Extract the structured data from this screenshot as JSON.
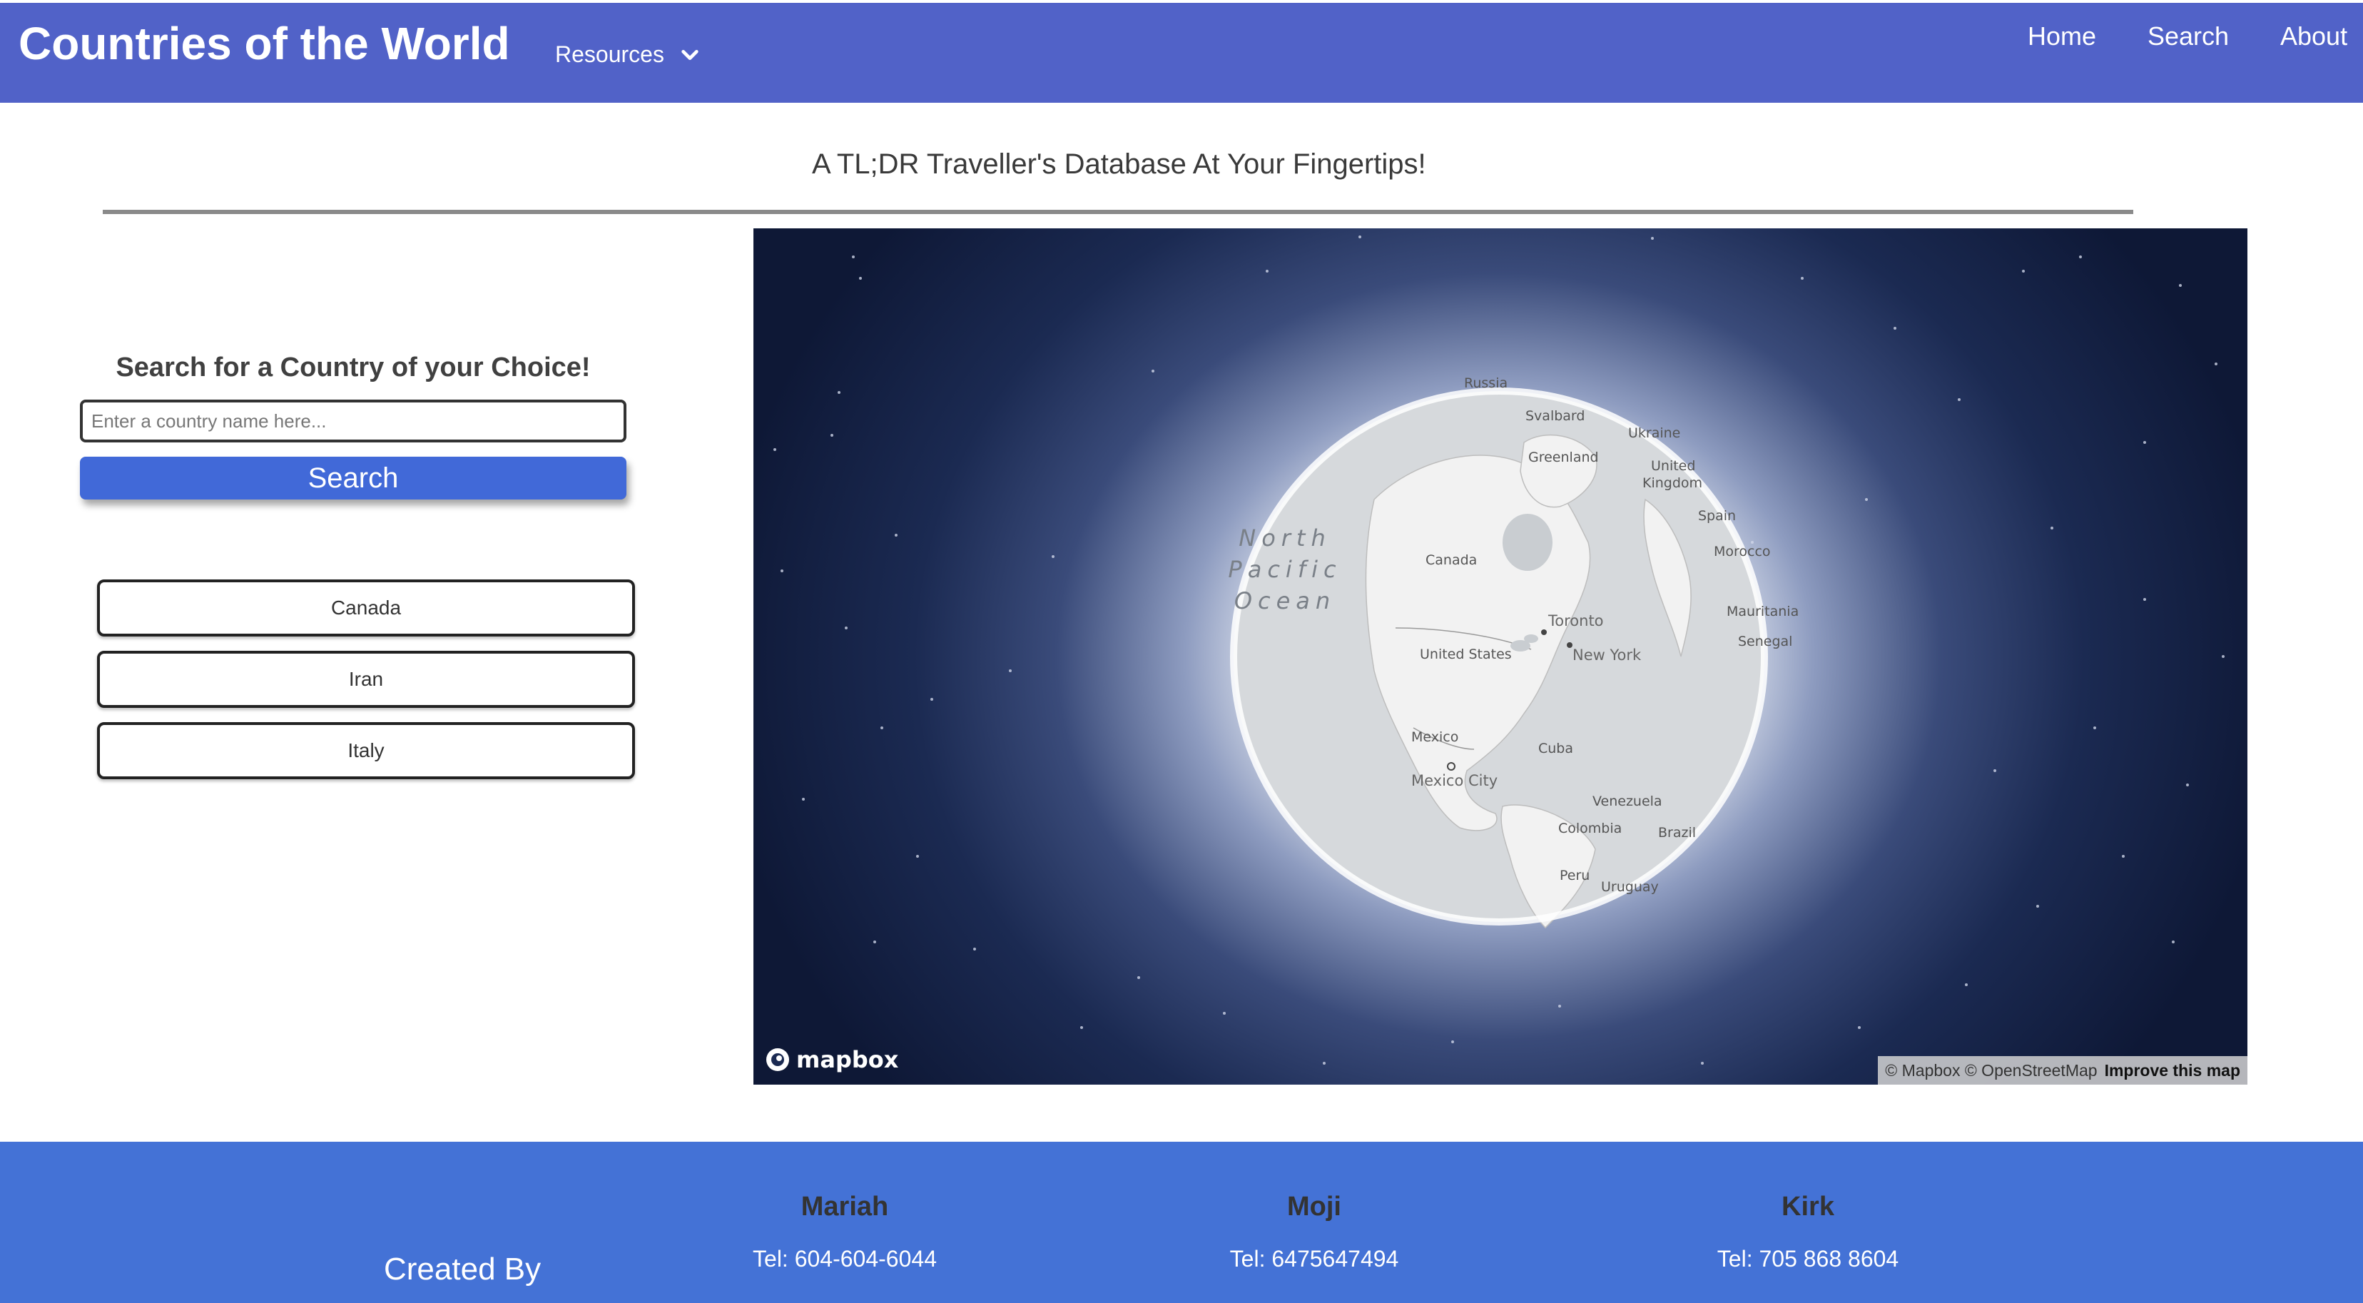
{
  "navbar": {
    "brand": "Countries of the World",
    "resources_label": "Resources",
    "links": [
      "Home",
      "Search",
      "About"
    ]
  },
  "tagline": "A TL;DR Traveller's Database At Your Fingertips!",
  "search": {
    "heading": "Search for a Country of your Choice!",
    "placeholder": "Enter a country name here...",
    "value": "",
    "button_label": "Search"
  },
  "country_buttons": [
    "Canada",
    "Iran",
    "Italy"
  ],
  "map": {
    "ocean_label": [
      "North",
      "Pacific",
      "Ocean"
    ],
    "labels": {
      "russia": "Russia",
      "svalbard": "Svalbard",
      "greenland": "Greenland",
      "ukraine": "Ukraine",
      "uk_line1": "United",
      "uk_line2": "Kingdom",
      "spain": "Spain",
      "morocco": "Morocco",
      "canada": "Canada",
      "toronto": "Toronto",
      "new_york": "New York",
      "mauritania": "Mauritania",
      "senegal": "Senegal",
      "united_states": "United States",
      "mexico": "Mexico",
      "mexico_city": "Mexico City",
      "cuba": "Cuba",
      "venezuela": "Venezuela",
      "colombia": "Colombia",
      "brazil": "Brazil",
      "peru": "Peru",
      "uruguay": "Uruguay"
    },
    "logo_text": "mapbox",
    "attribution": "© Mapbox © OpenStreetMap",
    "improve_link": "Improve this map"
  },
  "footer": {
    "created_by": "Created By",
    "members": [
      {
        "name": "Mariah",
        "tel": "Tel: 604-604-6044"
      },
      {
        "name": "Moji",
        "tel": "Tel: 6475647494"
      },
      {
        "name": "Kirk",
        "tel": "Tel: 705 868 8604"
      }
    ]
  },
  "colors": {
    "navbar": "#5162c8",
    "footer": "#4472d6",
    "search_button": "#4169d8"
  }
}
